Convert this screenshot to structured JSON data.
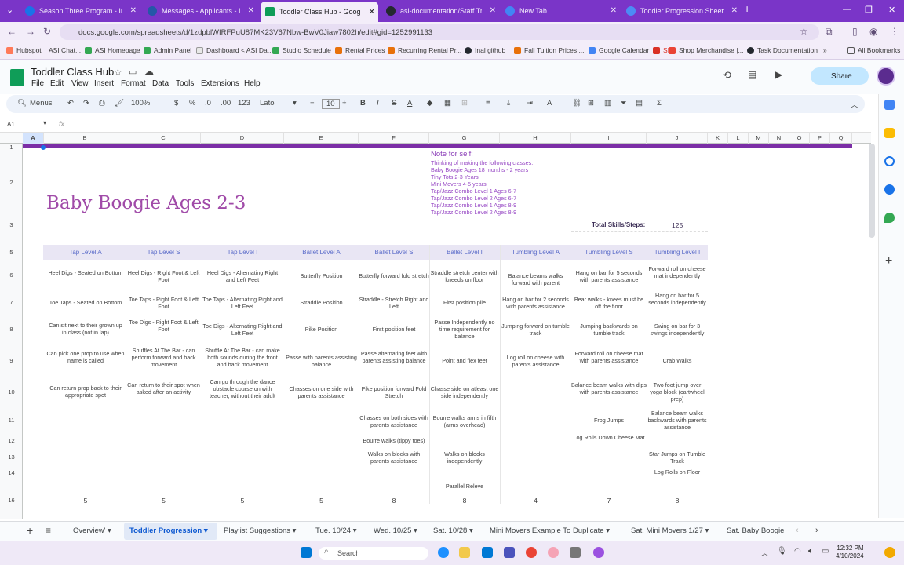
{
  "browser": {
    "tabs": [
      {
        "label": "Season Three Program - In Edit",
        "icon_color": "#1a73e8"
      },
      {
        "label": "Messages - Applicants - Indeed",
        "icon_color": "#2557a7"
      },
      {
        "label": "Toddler Class Hub - Google Sh...",
        "icon_color": "#0f9d58",
        "active": true
      },
      {
        "label": "asi-documentation/Staff Trainin...",
        "icon_color": "#24292f"
      },
      {
        "label": "New Tab",
        "icon_color": "#4285f4"
      },
      {
        "label": "Toddler Progression Sheet",
        "icon_color": "#4c8bf5"
      }
    ],
    "url": "docs.google.com/spreadsheets/d/1zdpblWIRFPuU87MK23V67Nbw-BwV0Jiaw7802h/edit#gid=1252991133",
    "bookmarks": [
      "Hubspot",
      "ASI Chat...",
      "ASI Homepage",
      "Admin Panel",
      "Dashboard < ASI Da...",
      "Studio Schedule",
      "Rental Prices",
      "Recurring Rental Pr...",
      "Inal github",
      "Fall Tuition Prices ...",
      "Google Calendar",
      "SI",
      "Shop Merchandise |...",
      "Task Documentation"
    ],
    "all_bookmarks": "All Bookmarks"
  },
  "sheets": {
    "title": "Toddler Class Hub",
    "menu": [
      "File",
      "Edit",
      "View",
      "Insert",
      "Format",
      "Data",
      "Tools",
      "Extensions",
      "Help"
    ],
    "share_label": "Share",
    "toolbar": {
      "menus": "Menus",
      "zoom": "100%",
      "currency": "$",
      "percent": "%",
      "dec_less": ".0",
      "dec_more": ".00",
      "number_format": "123",
      "font": "Lato",
      "font_size": "10"
    },
    "name_box": "A1",
    "fx": "fx",
    "columns": [
      "A",
      "B",
      "C",
      "D",
      "E",
      "F",
      "G",
      "H",
      "I",
      "J",
      "K",
      "L",
      "M",
      "N",
      "O",
      "P",
      "Q"
    ],
    "rows": [
      "1",
      "2",
      "3",
      "5",
      "6",
      "7",
      "8",
      "9",
      "10",
      "11",
      "12",
      "13",
      "14",
      "16"
    ]
  },
  "content": {
    "title": "Baby Boogie Ages 2-3",
    "note_head": "Note for self:",
    "note_lines": [
      "Thinking of making the following classes:",
      "Baby Boogie Ages 18 months - 2 years",
      "Tiny Tots 2-3 Years",
      "Mini Movers 4-5 years",
      "Tap/Jazz Combo Level 1 Ages 6-7",
      "Tap/Jazz Combo Level 2 Ages 6-7",
      "Tap/Jazz Combo Level 1 Ages 8-9",
      "Tap/Jazz Combo Level 2 Ages 8-9"
    ],
    "total_label": "Total Skills/Steps:",
    "total_value": "125",
    "headers": [
      "Tap Level A",
      "Tap Level S",
      "Tap Level I",
      "Ballet Level A",
      "Ballet Level S",
      "Ballet Level I",
      "Tumbling Level A",
      "Tumbling Level S",
      "Tumbling Level I"
    ],
    "columns": [
      [
        "Heel Digs - Seated on Bottom",
        "Toe Taps - Seated on Bottom",
        "Can sit next to their grown up in class (not in lap)",
        "Can pick one prop to use when name is called",
        "Can return prop back to their appropriate spot"
      ],
      [
        "Heel Digs - Right Foot & Left Foot",
        "Toe Taps - Right Foot & Left Foot",
        "Toe Digs - Right Foot & Left Foot",
        "Shuffles At The Bar - can perform forward and back movement",
        "Can return to their spot when asked after an activity"
      ],
      [
        "Heel Digs - Alternating Right and Left Feet",
        "Toe Taps - Alternating Right and Left Feet",
        "Toe Digs - Alternating Right and Left Feet",
        "Shuffle At The Bar - can make both sounds during the front and back movement",
        "Can go through the dance obstacle course on with teacher, without their adult"
      ],
      [
        "Butterfly Position",
        "Straddle Position",
        "Pike Position",
        "Passe with parents assisting balance",
        "Chasses on one side with parents assistance"
      ],
      [
        "Butterfly forward fold stretch",
        "Straddle - Stretch Right and Left",
        "First position feet",
        "Passe alternating feet with parents assisting balance",
        "Pike position forward Fold Stretch",
        "Chasses on both sides with parents assistance",
        "Bourre walks (tippy toes)",
        "Walks on blocks with parents assistance"
      ],
      [
        "Straddle stretch center with kneeds on floor",
        "First position plie",
        "Passe Independently no time requirement for balance",
        "Point and flex feet",
        "Chasse side on atleast one side independently",
        "Bourre walks arms in fifth (arms overhead)",
        "Walks on blocks independently",
        "Parallel Releve"
      ],
      [
        "Balance beams walks forward with parent",
        "Hang on bar for 2 seconds with parents assistance",
        "Jumping forward on tumble track",
        "Log roll on cheese with parents assistance"
      ],
      [
        "Hang on bar for 5 seconds with parents assistance",
        "Bear walks - knees must be off the floor",
        "Jumping backwards on tumble track",
        "Forward roll on cheese mat with parents assistance",
        "Balance beam walks with dips with parents assistance",
        "Frog Jumps",
        "Log Rolls Down Cheese Mat"
      ],
      [
        "Forward roll on cheese mat independently",
        "Hang on bar for 5 seconds independently",
        "Swing on bar for 3 swings independently",
        "Crab Walks",
        "Two foot jump over yoga block (cartwheel prep)",
        "Balance beam walks backwards with parents assistance",
        "Star Jumps on Tumble Track",
        "Log Rolls on Floor"
      ]
    ],
    "counts": [
      "5",
      "5",
      "5",
      "5",
      "8",
      "8",
      "4",
      "7",
      "8"
    ]
  },
  "sheet_tabs": [
    "Overview'",
    "Toddler Progression",
    "Playlist Suggestions",
    "Tue. 10/24",
    "Wed. 10/25",
    "Sat. 10/28",
    "Mini Movers Example To Duplicate",
    "Sat. Mini Movers 1/27",
    "Sat. Baby Boogie"
  ],
  "taskbar": {
    "search": "Search",
    "time": "12:32 PM",
    "date": "4/10/2024"
  },
  "colors": {
    "accent": "#7a35c8",
    "header_text": "#5a6bc9",
    "title": "#a04aa8"
  }
}
